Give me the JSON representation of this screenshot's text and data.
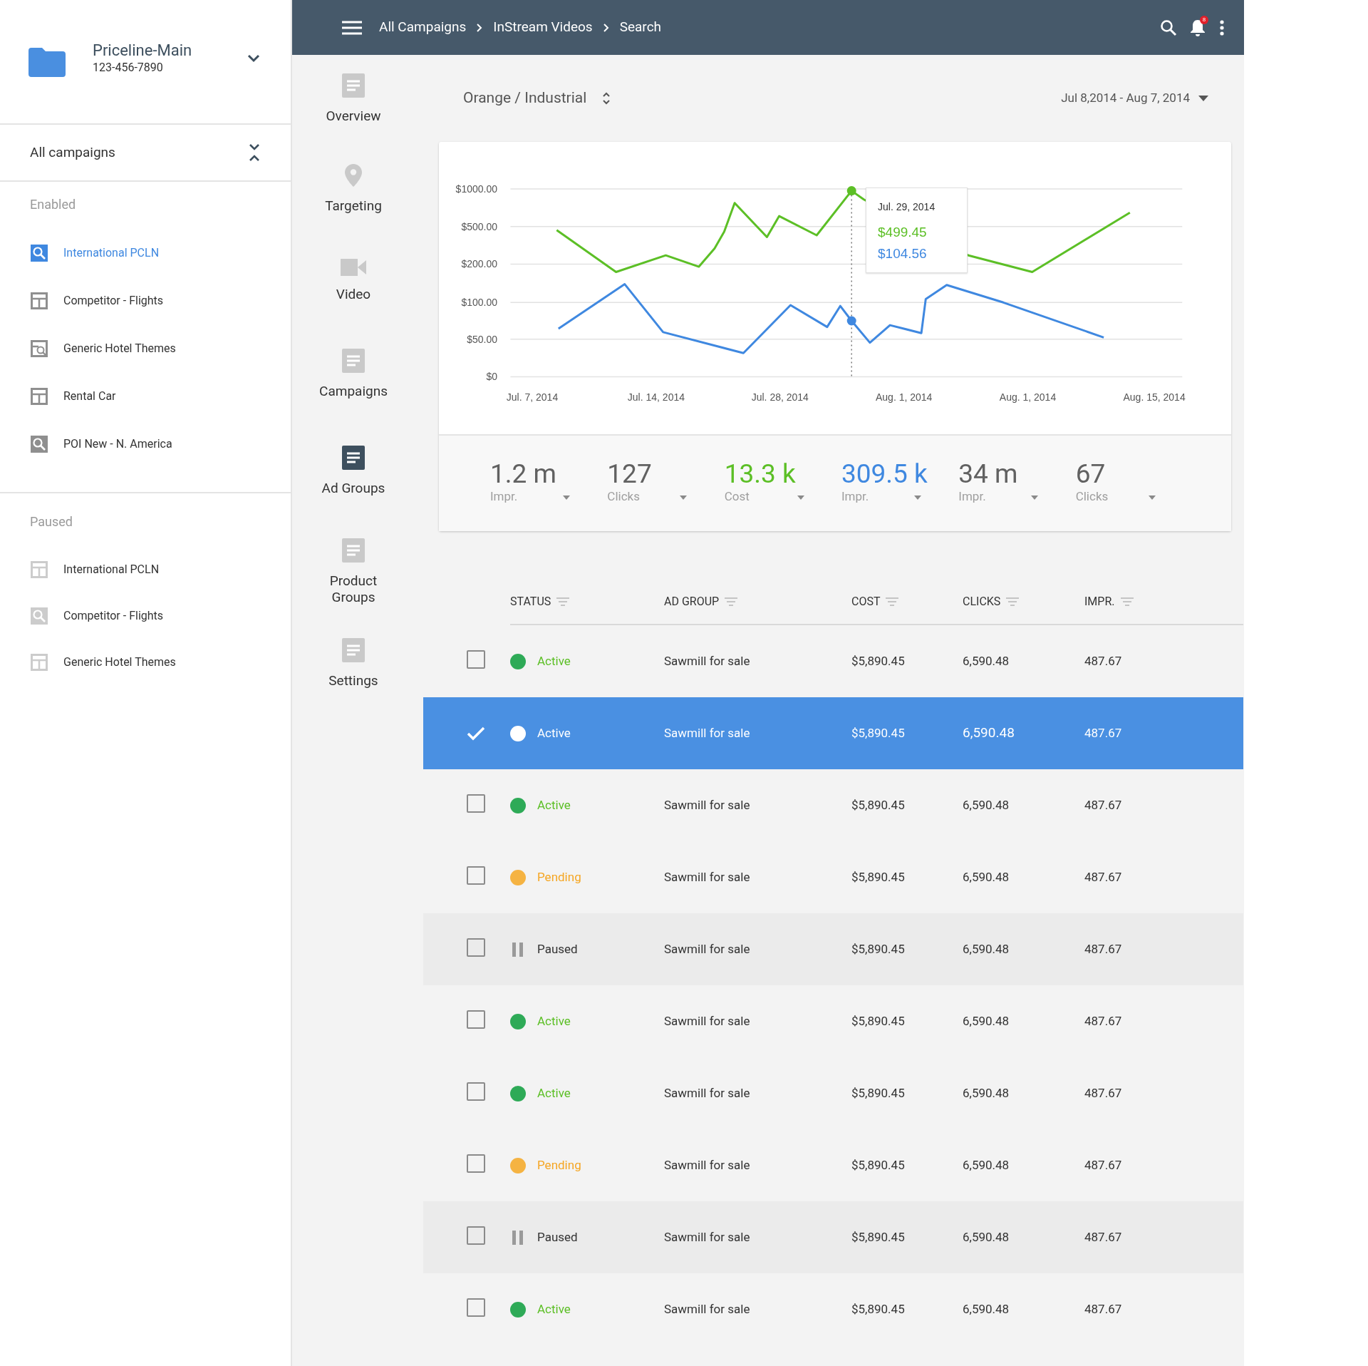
{
  "account": {
    "name": "Priceline-Main",
    "phone": "123-456-7890"
  },
  "campaign_filter": {
    "label": "All campaigns"
  },
  "sidebar_sections": [
    {
      "heading": "Enabled",
      "items": [
        {
          "label": "International PCLN",
          "kind": "search",
          "selected": true
        },
        {
          "label": "Competitor - Flights",
          "kind": "layout",
          "selected": false
        },
        {
          "label": "Generic Hotel Themes",
          "kind": "image-search",
          "selected": false
        },
        {
          "label": "Rental Car",
          "kind": "layout",
          "selected": false
        },
        {
          "label": "POI New - N. America",
          "kind": "search",
          "selected": false
        }
      ]
    },
    {
      "heading": "Paused",
      "items": [
        {
          "label": "International PCLN",
          "kind": "layout",
          "selected": false
        },
        {
          "label": "Competitor - Flights",
          "kind": "search",
          "selected": false
        },
        {
          "label": "Generic Hotel Themes",
          "kind": "layout",
          "selected": false
        }
      ]
    }
  ],
  "breadcrumbs": [
    "All Campaigns",
    "InStream Videos",
    "Search"
  ],
  "notification_count": "8",
  "nav": [
    {
      "label": "Overview",
      "kind": "doc",
      "selected": false
    },
    {
      "label": "Targeting",
      "kind": "pin",
      "selected": false
    },
    {
      "label": "Video",
      "kind": "video",
      "selected": false
    },
    {
      "label": "Campaigns",
      "kind": "doc",
      "selected": false
    },
    {
      "label": "Ad Groups",
      "kind": "doc",
      "selected": true
    },
    {
      "label": "Product Groups",
      "kind": "doc",
      "selected": false
    },
    {
      "label": "Settings",
      "kind": "doc",
      "selected": false
    }
  ],
  "ad_group_title": "Orange / Industrial",
  "date_range": "Jul 8,2014 - Aug 7, 2014",
  "chart": {
    "y_tick_labels": [
      "$1000.00",
      "$500.00",
      "$200.00",
      "$100.00",
      "$50.00",
      "$0"
    ],
    "x_tick_labels": [
      "Jul. 7, 2014",
      "Jul. 14, 2014",
      "Jul. 28, 2014",
      "Aug. 1, 2014",
      "Aug. 1, 2014",
      "Aug. 15, 2014"
    ],
    "tooltip": {
      "date": "Jul. 29, 2014",
      "values": [
        {
          "text": "$499.45",
          "color": "#5cbf26"
        },
        {
          "text": "$104.56",
          "color": "#3f88e0"
        }
      ]
    }
  },
  "stats": [
    {
      "value": "1.2 m",
      "label": "Impr.",
      "color": "#616161"
    },
    {
      "value": "127",
      "label": "Clicks",
      "color": "#616161"
    },
    {
      "value": "13.3 k",
      "label": "Cost",
      "color": "#5cbf26"
    },
    {
      "value": "309.5 k",
      "label": "Impr.",
      "color": "#3f88e0"
    },
    {
      "value": "34 m",
      "label": "Impr.",
      "color": "#616161"
    },
    {
      "value": "67",
      "label": "Clicks",
      "color": "#616161"
    }
  ],
  "table": {
    "columns": [
      "STATUS",
      "AD GROUP",
      "COST",
      "CLICKS",
      "IMPR."
    ],
    "rows": [
      {
        "status": "Active",
        "kind": "active",
        "selected": false,
        "ad_group": "Sawmill for sale",
        "cost": "$5,890.45",
        "clicks": "6,590.48",
        "impr": "487.67"
      },
      {
        "status": "Active",
        "kind": "active",
        "selected": true,
        "ad_group": "Sawmill for sale",
        "cost": "$5,890.45",
        "clicks": "6,590.48",
        "impr": "487.67"
      },
      {
        "status": "Active",
        "kind": "active",
        "selected": false,
        "ad_group": "Sawmill for sale",
        "cost": "$5,890.45",
        "clicks": "6,590.48",
        "impr": "487.67"
      },
      {
        "status": "Pending",
        "kind": "pending",
        "selected": false,
        "ad_group": "Sawmill for sale",
        "cost": "$5,890.45",
        "clicks": "6,590.48",
        "impr": "487.67"
      },
      {
        "status": "Paused",
        "kind": "paused",
        "selected": false,
        "ad_group": "Sawmill for sale",
        "cost": "$5,890.45",
        "clicks": "6,590.48",
        "impr": "487.67"
      },
      {
        "status": "Active",
        "kind": "active",
        "selected": false,
        "ad_group": "Sawmill for sale",
        "cost": "$5,890.45",
        "clicks": "6,590.48",
        "impr": "487.67"
      },
      {
        "status": "Active",
        "kind": "active",
        "selected": false,
        "ad_group": "Sawmill for sale",
        "cost": "$5,890.45",
        "clicks": "6,590.48",
        "impr": "487.67"
      },
      {
        "status": "Pending",
        "kind": "pending",
        "selected": false,
        "ad_group": "Sawmill for sale",
        "cost": "$5,890.45",
        "clicks": "6,590.48",
        "impr": "487.67"
      },
      {
        "status": "Paused",
        "kind": "paused",
        "selected": false,
        "ad_group": "Sawmill for sale",
        "cost": "$5,890.45",
        "clicks": "6,590.48",
        "impr": "487.67"
      },
      {
        "status": "Active",
        "kind": "active",
        "selected": false,
        "ad_group": "Sawmill for sale",
        "cost": "$5,890.45",
        "clicks": "6,590.48",
        "impr": "487.67"
      }
    ]
  }
}
